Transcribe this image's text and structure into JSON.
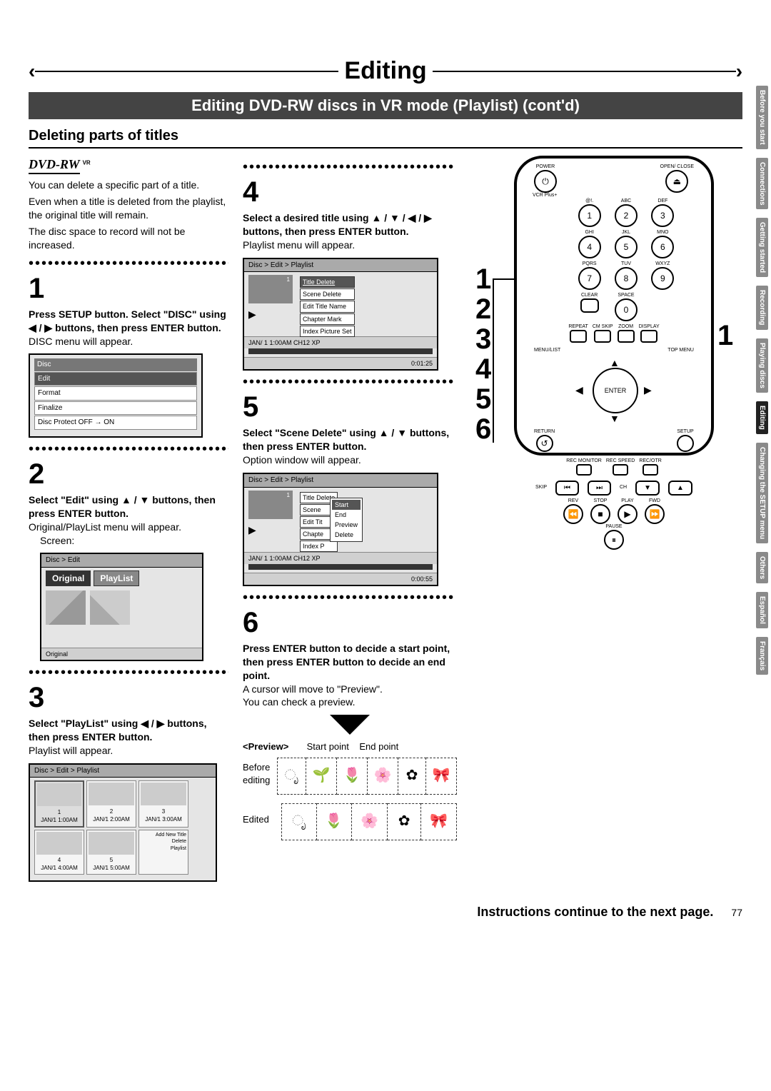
{
  "title": "Editing",
  "subtitle": "Editing DVD-RW discs in VR mode (Playlist) (cont'd)",
  "heading": "Deleting parts of titles",
  "dvd_logo_text": "DVD-RW",
  "dvd_logo_vr": "VR",
  "intro": {
    "p1": "You can delete a specific part of a title.",
    "p2": "Even when a title is deleted from the playlist, the original title will remain.",
    "p3": "The disc space to record will not be increased."
  },
  "step1": {
    "num": "1",
    "bold_l1": "Press SETUP button. Select \"DISC\" using ◀ / ▶ buttons, then press ENTER button.",
    "text": "DISC menu will appear.",
    "screen": {
      "title": "Disc",
      "items": [
        "Edit",
        "Format",
        "Finalize",
        "Disc Protect OFF → ON"
      ],
      "selected": "Edit"
    }
  },
  "step2": {
    "num": "2",
    "bold": "Select \"Edit\" using ▲ / ▼ buttons, then press ENTER button.",
    "text": "Original/PlayList menu will appear.",
    "sub": "Screen:",
    "screen": {
      "title": "Disc > Edit",
      "tab1": "Original",
      "tab2": "PlayList",
      "status": "Original"
    }
  },
  "step3": {
    "num": "3",
    "bold": "Select \"PlayList\" using ◀ / ▶ buttons, then press ENTER button.",
    "text": "Playlist will appear.",
    "screen": {
      "title": "Disc > Edit > Playlist",
      "thumbs": [
        {
          "n": "1",
          "t": "JAN/1   1:00AM"
        },
        {
          "n": "2",
          "t": "JAN/1   2:00AM"
        },
        {
          "n": "3",
          "t": "JAN/1   3:00AM"
        },
        {
          "n": "4",
          "t": "JAN/1   4:00AM"
        },
        {
          "n": "5",
          "t": "JAN/1   5:00AM"
        }
      ],
      "addnew": "Add New Title",
      "opts": [
        "Delete",
        "Playlist"
      ]
    }
  },
  "step4": {
    "num": "4",
    "bold": "Select a desired title using ▲ / ▼ / ◀ / ▶ buttons, then press ENTER button.",
    "text": "Playlist menu will appear.",
    "screen": {
      "title": "Disc > Edit > Playlist",
      "thumb_n": "1",
      "items": [
        "Title Delete",
        "Scene Delete",
        "Edit Title Name",
        "Chapter Mark",
        "Index Picture Set"
      ],
      "selected": "Title Delete",
      "status_l": "JAN/ 1   1:00AM  CH12    XP",
      "status_r": "0:01:25"
    }
  },
  "step5": {
    "num": "5",
    "bold": "Select \"Scene Delete\" using ▲ / ▼ buttons, then press ENTER button.",
    "text": "Option window will appear.",
    "screen": {
      "title": "Disc > Edit > Playlist",
      "thumb_n": "1",
      "items": [
        "Title Delete",
        "Scene",
        "Edit Tit",
        "Chapte",
        "Index P"
      ],
      "popup": [
        "Start",
        "End",
        "Preview",
        "Delete"
      ],
      "popup_sel": "Start",
      "status_l": "JAN/ 1   1:00AM  CH12    XP",
      "status_r": "0:00:55"
    }
  },
  "step6": {
    "num": "6",
    "bold": "Press ENTER button to decide a start point, then press ENTER button to decide an end point.",
    "text_l1": "A cursor will move to \"Preview\".",
    "text_l2": "You can check a preview."
  },
  "big_nums": [
    "1",
    "2",
    "3",
    "4",
    "5",
    "6"
  ],
  "big_one_callout": "1",
  "remote": {
    "top_labels": {
      "power": "POWER",
      "open": "OPEN/\nCLOSE"
    },
    "vcrplus": "VCR Plus+",
    "numpad": [
      {
        "sup": "@!.",
        "d": "1"
      },
      {
        "sup": "ABC",
        "d": "2"
      },
      {
        "sup": "DEF",
        "d": "3"
      },
      {
        "sup": "GHI",
        "d": "4"
      },
      {
        "sup": "JKL",
        "d": "5"
      },
      {
        "sup": "MNO",
        "d": "6"
      },
      {
        "sup": "PQRS",
        "d": "7"
      },
      {
        "sup": "TUV",
        "d": "8"
      },
      {
        "sup": "WXYZ",
        "d": "9"
      },
      {
        "sup": "CLEAR",
        "d": " "
      },
      {
        "sup": "SPACE",
        "d": "0"
      },
      {
        "sup": "",
        "d": ""
      }
    ],
    "row_labels": [
      "REPEAT",
      "CM SKIP",
      "ZOOM",
      "DISPLAY"
    ],
    "menu_l": "MENU/LIST",
    "menu_r": "TOP MENU",
    "enter": "ENTER",
    "return": "RETURN",
    "setup": "SETUP",
    "rec_row": [
      "REC\nMONITOR",
      "REC\nSPEED",
      "REC/OTR"
    ],
    "skip": "SKIP",
    "ch": "CH",
    "transport_labels": [
      "REV",
      "STOP",
      "PLAY",
      "FWD"
    ],
    "pause": "PAUSE"
  },
  "preview": {
    "heading": "<Preview>",
    "start": "Start point",
    "end": "End point",
    "row1": "Before editing",
    "row2": "Edited",
    "glyphs_before": [
      "ೃ",
      "🌱",
      "🌷",
      "🌸",
      "✿",
      "🎀"
    ],
    "glyphs_after": [
      "ೃ",
      "🌷",
      "🌸",
      "✿",
      "🎀"
    ]
  },
  "side_tabs": [
    "Before you start",
    "Connections",
    "Getting started",
    "Recording",
    "Playing discs",
    "Editing",
    "Changing the SETUP menu",
    "Others",
    "Español",
    "Français"
  ],
  "side_tab_active_index": 5,
  "footer": "Instructions continue to the next page.",
  "page_number": "77"
}
